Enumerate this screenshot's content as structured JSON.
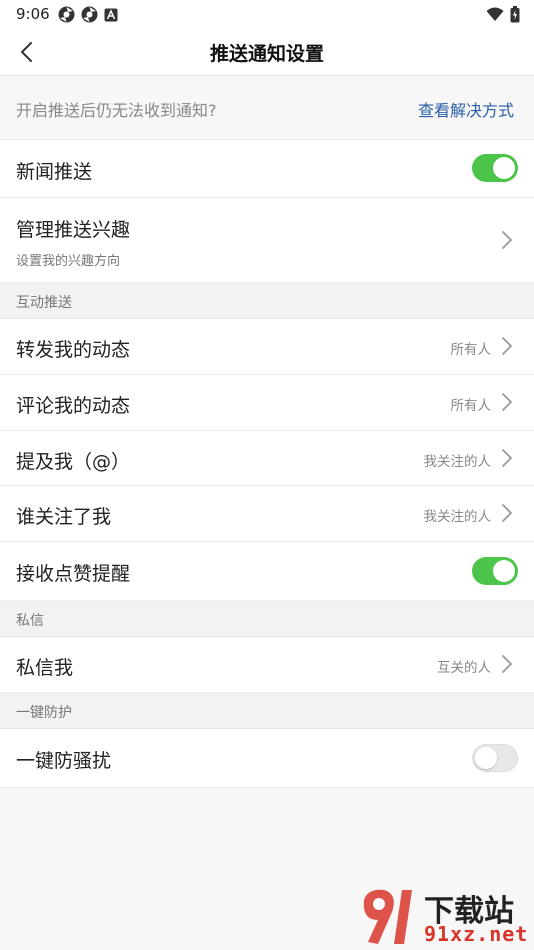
{
  "status_bar": {
    "time": "9:06"
  },
  "nav": {
    "title": "推送通知设置"
  },
  "help": {
    "text": "开启推送后仍无法收到通知?",
    "link": "查看解决方式"
  },
  "news_push": {
    "label": "新闻推送",
    "enabled": true
  },
  "interest": {
    "label": "管理推送兴趣",
    "sub": "设置我的兴趣方向"
  },
  "section_interaction": {
    "title": "互动推送",
    "rows": [
      {
        "label": "转发我的动态",
        "value": "所有人"
      },
      {
        "label": "评论我的动态",
        "value": "所有人"
      },
      {
        "label": "提及我（@）",
        "value": "我关注的人"
      },
      {
        "label": "谁关注了我",
        "value": "我关注的人"
      }
    ],
    "like_row": {
      "label": "接收点赞提醒",
      "enabled": true
    }
  },
  "section_dm": {
    "title": "私信",
    "row": {
      "label": "私信我",
      "value": "互关的人"
    }
  },
  "section_protect": {
    "title": "一键防护",
    "row": {
      "label": "一键防骚扰",
      "enabled": false
    }
  },
  "watermark": {
    "top": "下载站",
    "bottom": "91xz.net"
  },
  "colors": {
    "toggle_on": "#4cc54a",
    "link": "#2a5ea8"
  }
}
